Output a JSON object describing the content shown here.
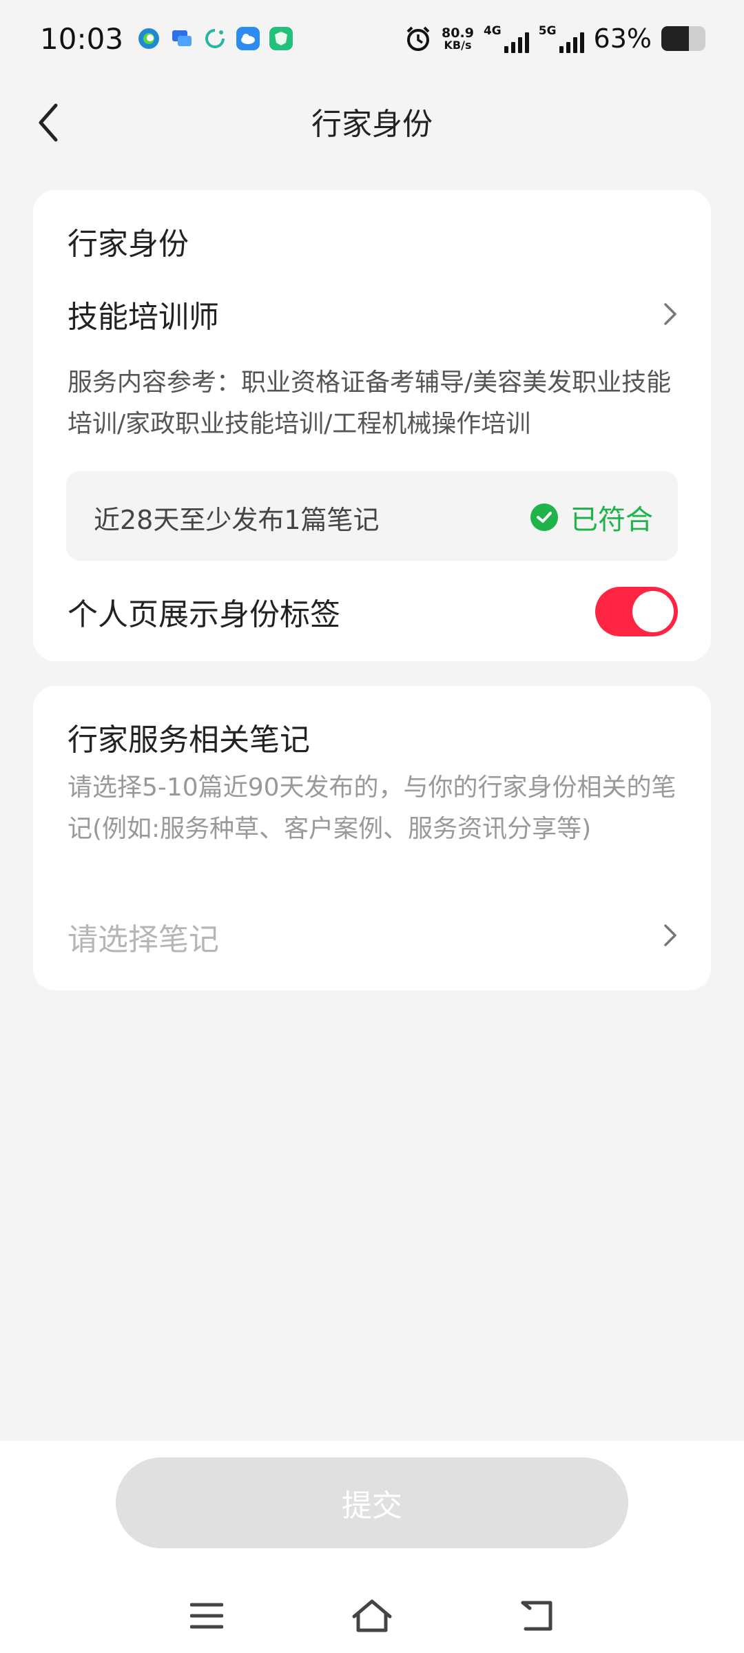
{
  "status_bar": {
    "time": "10:03",
    "net_speed_value": "80.9",
    "net_speed_unit": "KB/s",
    "sim1_label": "4G",
    "sim2_label": "5G",
    "battery_percent": "63%",
    "battery_level": 0.63,
    "notification_icons": [
      "edge-icon",
      "chat-icon",
      "sync-icon",
      "cloud-icon",
      "shield-icon"
    ]
  },
  "header": {
    "title": "行家身份"
  },
  "identity_card": {
    "section_title": "行家身份",
    "identity_value": "技能培训师",
    "description": "服务内容参考：职业资格证备考辅导/美容美发职业技能培训/家政职业技能培训/工程机械操作培训",
    "requirement_text": "近28天至少发布1篇笔记",
    "requirement_status": "已符合",
    "toggle_label": "个人页展示身份标签",
    "toggle_on": true
  },
  "notes_card": {
    "section_title": "行家服务相关笔记",
    "description": "请选择5-10篇近90天发布的，与你的行家身份相关的笔记(例如:服务种草、客户案例、服务资讯分享等)",
    "select_placeholder": "请选择笔记"
  },
  "footer": {
    "submit_label": "提交"
  },
  "colors": {
    "accent_red": "#ff2442",
    "success_green": "#1fb349",
    "disabled_button": "#e0e0e0"
  }
}
